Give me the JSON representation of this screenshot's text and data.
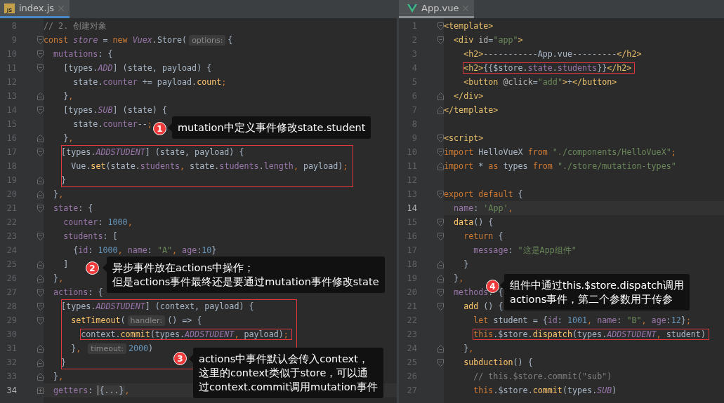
{
  "panes": [
    {
      "tab": {
        "label": "index.js",
        "icon_text": "JS",
        "selected": true
      },
      "lines": [
        {
          "number": "8",
          "tokens": [
            {
              "kind": "cmt",
              "t": "// 2. 创建对象"
            }
          ]
        },
        {
          "number": "9",
          "fold_start": true,
          "tokens": [
            {
              "kind": "kw",
              "t": "const "
            },
            {
              "kind": "const",
              "t": "store"
            },
            {
              "kind": "plain",
              "t": " = "
            },
            {
              "kind": "kw",
              "t": "new "
            },
            {
              "kind": "const",
              "t": "Vuex"
            },
            {
              "kind": "plain",
              "t": ".Store("
            },
            {
              "kind": "hint",
              "t": "options:"
            },
            {
              "kind": "plain",
              "t": "{"
            }
          ]
        },
        {
          "number": "10",
          "fold_start": true,
          "tokens": [
            {
              "kind": "prop",
              "t": "  mutations"
            },
            {
              "kind": "plain",
              "t": ": {"
            }
          ]
        },
        {
          "number": "11",
          "fold_start": true,
          "tokens": [
            {
              "kind": "plain",
              "t": "    [types."
            },
            {
              "kind": "const",
              "t": "ADD"
            },
            {
              "kind": "plain",
              "t": "] (state, payload) {"
            }
          ]
        },
        {
          "number": "12",
          "tokens": [
            {
              "kind": "plain",
              "t": "      state."
            },
            {
              "kind": "prop",
              "t": "counter"
            },
            {
              "kind": "plain",
              "t": " += payload."
            },
            {
              "kind": "fn",
              "t": "count"
            },
            {
              "kind": "kw",
              "t": ";"
            }
          ]
        },
        {
          "number": "13",
          "fold_end": true,
          "tokens": [
            {
              "kind": "plain",
              "t": "    }"
            },
            {
              "kind": "kw",
              "t": ","
            }
          ]
        },
        {
          "number": "14",
          "fold_start": true,
          "tokens": [
            {
              "kind": "plain",
              "t": "    [types."
            },
            {
              "kind": "const",
              "t": "SUB"
            },
            {
              "kind": "plain",
              "t": "] (state) {"
            }
          ]
        },
        {
          "number": "15",
          "tokens": [
            {
              "kind": "plain",
              "t": "      state."
            },
            {
              "kind": "prop",
              "t": "counter"
            },
            {
              "kind": "plain",
              "t": "--"
            },
            {
              "kind": "kw",
              "t": ";"
            }
          ]
        },
        {
          "number": "16",
          "fold_end": true,
          "tokens": [
            {
              "kind": "plain",
              "t": "    }"
            },
            {
              "kind": "kw",
              "t": ","
            }
          ]
        },
        {
          "number": "17",
          "fold_start": true,
          "boxed": true,
          "tokens": [
            {
              "kind": "plain",
              "t": "    [types."
            },
            {
              "kind": "const",
              "t": "ADDSTUDENT"
            },
            {
              "kind": "plain",
              "t": "] (state, payload) {"
            }
          ]
        },
        {
          "number": "18",
          "boxed": true,
          "tokens": [
            {
              "kind": "plain",
              "t": "      Vue."
            },
            {
              "kind": "fn",
              "t": "set"
            },
            {
              "kind": "plain",
              "t": "(state."
            },
            {
              "kind": "prop",
              "t": "students"
            },
            {
              "kind": "kw",
              "t": ", "
            },
            {
              "kind": "plain",
              "t": "state."
            },
            {
              "kind": "prop",
              "t": "students"
            },
            {
              "kind": "plain",
              "t": "."
            },
            {
              "kind": "prop",
              "t": "length"
            },
            {
              "kind": "kw",
              "t": ", "
            },
            {
              "kind": "plain",
              "t": "payload)"
            },
            {
              "kind": "kw",
              "t": ";"
            }
          ]
        },
        {
          "number": "19",
          "fold_end": true,
          "boxed": true,
          "tokens": [
            {
              "kind": "plain",
              "t": "    }"
            }
          ]
        },
        {
          "number": "20",
          "fold_end": true,
          "tokens": [
            {
              "kind": "plain",
              "t": "  }"
            },
            {
              "kind": "kw",
              "t": ","
            }
          ]
        },
        {
          "number": "21",
          "fold_start": true,
          "tokens": [
            {
              "kind": "prop",
              "t": "  state"
            },
            {
              "kind": "plain",
              "t": ": {"
            }
          ]
        },
        {
          "number": "22",
          "tokens": [
            {
              "kind": "prop",
              "t": "    counter"
            },
            {
              "kind": "plain",
              "t": ": "
            },
            {
              "kind": "num",
              "t": "1000"
            },
            {
              "kind": "kw",
              "t": ","
            }
          ]
        },
        {
          "number": "23",
          "fold_start": true,
          "tokens": [
            {
              "kind": "prop",
              "t": "    students"
            },
            {
              "kind": "plain",
              "t": ": ["
            }
          ]
        },
        {
          "number": "24",
          "tokens": [
            {
              "kind": "plain",
              "t": "      {"
            },
            {
              "kind": "prop",
              "t": "id"
            },
            {
              "kind": "plain",
              "t": ": "
            },
            {
              "kind": "num",
              "t": "1000"
            },
            {
              "kind": "kw",
              "t": ", "
            },
            {
              "kind": "prop",
              "t": "name"
            },
            {
              "kind": "plain",
              "t": ": "
            },
            {
              "kind": "str",
              "t": "\"A\""
            },
            {
              "kind": "kw",
              "t": ", "
            },
            {
              "kind": "prop",
              "t": "age"
            },
            {
              "kind": "plain",
              "t": ":"
            },
            {
              "kind": "num",
              "t": "10"
            },
            {
              "kind": "plain",
              "t": "}"
            }
          ]
        },
        {
          "number": "25",
          "fold_end": true,
          "tokens": [
            {
              "kind": "plain",
              "t": "    ]"
            }
          ]
        },
        {
          "number": "26",
          "fold_end": true,
          "tokens": [
            {
              "kind": "plain",
              "t": "  }"
            },
            {
              "kind": "kw",
              "t": ","
            }
          ]
        },
        {
          "number": "27",
          "fold_start": true,
          "tokens": [
            {
              "kind": "prop",
              "t": "  actions"
            },
            {
              "kind": "plain",
              "t": ": {"
            }
          ]
        },
        {
          "number": "28",
          "fold_start": true,
          "boxed": true,
          "tokens": [
            {
              "kind": "plain",
              "t": "    [types."
            },
            {
              "kind": "const",
              "t": "ADDSTUDENT"
            },
            {
              "kind": "plain",
              "t": "] (context, payload) {"
            }
          ]
        },
        {
          "number": "29",
          "fold_start": true,
          "boxed": true,
          "tokens": [
            {
              "kind": "fn",
              "t": "      setTimeout"
            },
            {
              "kind": "plain",
              "t": "("
            },
            {
              "kind": "hint",
              "t": "handler:"
            },
            {
              "kind": "plain",
              "t": "() => {"
            }
          ]
        },
        {
          "number": "30",
          "boxed": true,
          "marked": true,
          "tokens": [
            {
              "kind": "plain",
              "t": "        context."
            },
            {
              "kind": "fn",
              "t": "commit"
            },
            {
              "kind": "plain",
              "t": "(types."
            },
            {
              "kind": "const",
              "t": "ADDSTUDENT"
            },
            {
              "kind": "kw",
              "t": ", "
            },
            {
              "kind": "plain",
              "t": "payload)"
            },
            {
              "kind": "kw",
              "t": ";"
            }
          ]
        },
        {
          "number": "31",
          "fold_end": true,
          "boxed": true,
          "tokens": [
            {
              "kind": "plain",
              "t": "      }"
            },
            {
              "kind": "kw",
              "t": ", "
            },
            {
              "kind": "hint",
              "t": "timeout:"
            },
            {
              "kind": "num",
              "t": "2000"
            },
            {
              "kind": "plain",
              "t": ")"
            }
          ]
        },
        {
          "number": "32",
          "fold_end": true,
          "boxed": true,
          "tokens": [
            {
              "kind": "plain",
              "t": "    }"
            }
          ]
        },
        {
          "number": "33",
          "fold_end": true,
          "tokens": [
            {
              "kind": "plain",
              "t": "  }"
            },
            {
              "kind": "kw",
              "t": ","
            }
          ]
        },
        {
          "number": "34",
          "collapsed": true,
          "current": true,
          "tokens": [
            {
              "kind": "prop",
              "t": "  getters"
            },
            {
              "kind": "plain",
              "t": ": "
            },
            {
              "kind": "folded",
              "t": "{...}"
            },
            {
              "kind": "kw",
              "t": ","
            }
          ]
        }
      ]
    },
    {
      "tab": {
        "label": "App.vue",
        "selected": true
      },
      "lines": [
        {
          "number": "1",
          "fold_start": true,
          "tokens": [
            {
              "kind": "tag",
              "t": "<template>"
            }
          ]
        },
        {
          "number": "2",
          "fold_start": true,
          "tokens": [
            {
              "kind": "tag",
              "t": "  <div "
            },
            {
              "kind": "attr",
              "t": "id"
            },
            {
              "kind": "plain",
              "t": "="
            },
            {
              "kind": "str",
              "t": "\"app\""
            },
            {
              "kind": "tag",
              "t": ">"
            }
          ]
        },
        {
          "number": "3",
          "tokens": [
            {
              "kind": "tag",
              "t": "    <h2>"
            },
            {
              "kind": "plain",
              "t": "-----------App.vue---------"
            },
            {
              "kind": "tag",
              "t": "</h2>"
            }
          ]
        },
        {
          "number": "4",
          "marked": true,
          "tokens": [
            {
              "kind": "tag",
              "t": "    <h2>"
            },
            {
              "kind": "plain",
              "t": "{{$store."
            },
            {
              "kind": "prop",
              "t": "state"
            },
            {
              "kind": "plain",
              "t": "."
            },
            {
              "kind": "prop",
              "t": "students"
            },
            {
              "kind": "plain",
              "t": "}}"
            },
            {
              "kind": "tag",
              "t": "</h2>"
            }
          ]
        },
        {
          "number": "5",
          "tokens": [
            {
              "kind": "tag",
              "t": "    <button "
            },
            {
              "kind": "attr",
              "t": "@click"
            },
            {
              "kind": "plain",
              "t": "="
            },
            {
              "kind": "str",
              "t": "\"add\""
            },
            {
              "kind": "tag",
              "t": ">"
            },
            {
              "kind": "plain",
              "t": "+"
            },
            {
              "kind": "tag",
              "t": "</button>"
            }
          ]
        },
        {
          "number": "6",
          "fold_end": true,
          "tokens": [
            {
              "kind": "tag",
              "t": "  </div>"
            }
          ]
        },
        {
          "number": "7",
          "fold_end": true,
          "tokens": [
            {
              "kind": "tag",
              "t": "</template>"
            }
          ]
        },
        {
          "number": "8"
        },
        {
          "number": "9",
          "fold_start": true,
          "tokens": [
            {
              "kind": "tag",
              "t": "<script>"
            }
          ]
        },
        {
          "number": "10",
          "fold_start": true,
          "tokens": [
            {
              "kind": "kw",
              "t": "import "
            },
            {
              "kind": "plain",
              "t": "HelloVueX "
            },
            {
              "kind": "kw",
              "t": "from "
            },
            {
              "kind": "str",
              "t": "\"./components/HelloVueX\""
            },
            {
              "kind": "kw",
              "t": ";"
            }
          ]
        },
        {
          "number": "11",
          "fold_end": true,
          "tokens": [
            {
              "kind": "kw",
              "t": "import "
            },
            {
              "kind": "plain",
              "t": "* "
            },
            {
              "kind": "kw",
              "t": "as "
            },
            {
              "kind": "plain",
              "t": "types "
            },
            {
              "kind": "kw",
              "t": "from "
            },
            {
              "kind": "str",
              "t": "\"./store/mutation-types\""
            }
          ]
        },
        {
          "number": "12"
        },
        {
          "number": "13",
          "fold_start": true,
          "tokens": [
            {
              "kind": "kw",
              "t": "export default "
            },
            {
              "kind": "plain",
              "t": "{"
            }
          ]
        },
        {
          "number": "14",
          "current": true,
          "tokens": [
            {
              "kind": "prop",
              "t": "  name"
            },
            {
              "kind": "plain",
              "t": ": "
            },
            {
              "kind": "str",
              "t": "'App'"
            },
            {
              "kind": "kw",
              "t": ","
            }
          ]
        },
        {
          "number": "15",
          "fold_start": true,
          "tokens": [
            {
              "kind": "fn",
              "t": "  data"
            },
            {
              "kind": "plain",
              "t": "() {"
            }
          ]
        },
        {
          "number": "16",
          "fold_start": true,
          "tokens": [
            {
              "kind": "kw",
              "t": "    return "
            },
            {
              "kind": "plain",
              "t": "{"
            }
          ]
        },
        {
          "number": "17",
          "tokens": [
            {
              "kind": "prop",
              "t": "      message"
            },
            {
              "kind": "plain",
              "t": ": "
            },
            {
              "kind": "str",
              "t": "\"这是App组件\""
            }
          ]
        },
        {
          "number": "18",
          "fold_end": true,
          "tokens": [
            {
              "kind": "plain",
              "t": "    }"
            }
          ]
        },
        {
          "number": "19",
          "fold_end": true,
          "tokens": [
            {
              "kind": "plain",
              "t": "  }"
            },
            {
              "kind": "kw",
              "t": ","
            }
          ]
        },
        {
          "number": "20",
          "fold_start": true,
          "tokens": [
            {
              "kind": "prop",
              "t": "  methods"
            },
            {
              "kind": "plain",
              "t": ": {"
            }
          ]
        },
        {
          "number": "21",
          "fold_start": true,
          "tokens": [
            {
              "kind": "fn",
              "t": "    add"
            },
            {
              "kind": "plain",
              "t": " () {"
            }
          ]
        },
        {
          "number": "22",
          "tokens": [
            {
              "kind": "kw",
              "t": "      let "
            },
            {
              "kind": "plain",
              "t": "student = {"
            },
            {
              "kind": "prop",
              "t": "id"
            },
            {
              "kind": "plain",
              "t": ": "
            },
            {
              "kind": "num",
              "t": "1001"
            },
            {
              "kind": "kw",
              "t": ", "
            },
            {
              "kind": "prop",
              "t": "name"
            },
            {
              "kind": "plain",
              "t": ": "
            },
            {
              "kind": "str",
              "t": "\"B\""
            },
            {
              "kind": "kw",
              "t": ", "
            },
            {
              "kind": "prop",
              "t": "age"
            },
            {
              "kind": "plain",
              "t": ":"
            },
            {
              "kind": "num",
              "t": "12"
            },
            {
              "kind": "plain",
              "t": "}"
            },
            {
              "kind": "kw",
              "t": ";"
            }
          ]
        },
        {
          "number": "23",
          "marked": true,
          "tokens": [
            {
              "kind": "kw",
              "t": "      this"
            },
            {
              "kind": "plain",
              "t": ".$store."
            },
            {
              "kind": "fn",
              "t": "dispatch"
            },
            {
              "kind": "plain",
              "t": "(types."
            },
            {
              "kind": "const",
              "t": "ADDSTUDENT"
            },
            {
              "kind": "kw",
              "t": ", "
            },
            {
              "kind": "plain",
              "t": "student)"
            }
          ]
        },
        {
          "number": "24",
          "fold_end": true,
          "tokens": [
            {
              "kind": "plain",
              "t": "    }"
            },
            {
              "kind": "kw",
              "t": ","
            }
          ]
        },
        {
          "number": "25",
          "fold_start": true,
          "tokens": [
            {
              "kind": "fn",
              "t": "    subduction"
            },
            {
              "kind": "plain",
              "t": "() {"
            }
          ]
        },
        {
          "number": "26",
          "tokens": [
            {
              "kind": "cmt",
              "t": "      // this.$store.commit(\"sub\")"
            }
          ]
        },
        {
          "number": "27",
          "tokens": [
            {
              "kind": "kw",
              "t": "      this"
            },
            {
              "kind": "plain",
              "t": ".$store."
            },
            {
              "kind": "fn",
              "t": "commit"
            },
            {
              "kind": "plain",
              "t": "(types."
            },
            {
              "kind": "const",
              "t": "SUB"
            },
            {
              "kind": "plain",
              "t": ")"
            }
          ]
        }
      ]
    }
  ],
  "callouts": [
    {
      "number": "1",
      "lines": [
        "mutation中定义事件修改state.student"
      ]
    },
    {
      "number": "2",
      "lines": [
        "异步事件放在actions中操作；",
        "但是actions事件最终还是要通过mutation事件修改state"
      ]
    },
    {
      "number": "3",
      "lines": [
        "actions中事件默认会传入context，",
        "这里的context类似于store，可以通",
        "过context.commit调用mutation事件"
      ]
    },
    {
      "number": "4",
      "lines": [
        "组件中通过this.$store.dispatch调用",
        "actions事件，第二个参数用于传参"
      ]
    }
  ]
}
